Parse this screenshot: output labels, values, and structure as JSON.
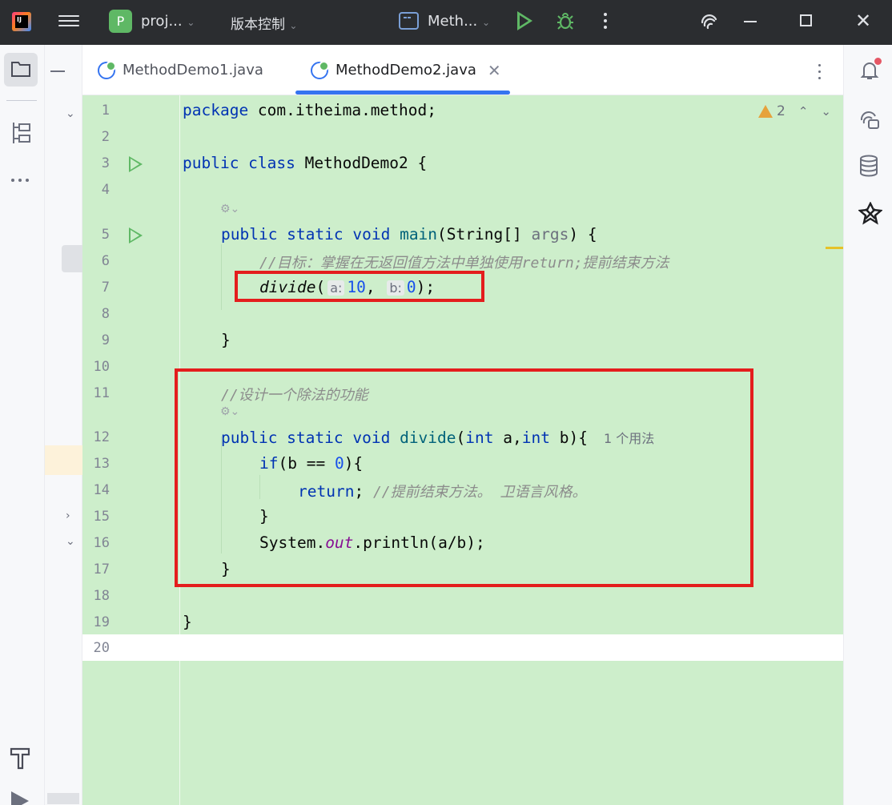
{
  "titlebar": {
    "project_badge": "P",
    "project_name": "proj...",
    "vcs_label": "版本控制",
    "run_config": "Meth...",
    "close_glyph": "✕"
  },
  "tabs": [
    {
      "label": "MethodDemo1.java",
      "active": false
    },
    {
      "label": "MethodDemo2.java",
      "active": true
    }
  ],
  "tab_close_glyph": "✕",
  "editor": {
    "warnings_count": "2",
    "lines": [
      {
        "n": "1",
        "code": "package com.itheima.method;"
      },
      {
        "n": "2",
        "code": ""
      },
      {
        "n": "3",
        "code": "public class MethodDemo2 {"
      },
      {
        "n": "4",
        "code": ""
      },
      {
        "n": "5",
        "code": "public static void main(String[] args) {"
      },
      {
        "n": "6",
        "code": "//目标：掌握在无返回值方法中单独使用return;提前结束方法"
      },
      {
        "n": "7",
        "code": "divide( a: 10, b: 0);",
        "call": "divide",
        "hint_a": "a:",
        "arg_a": "10",
        "hint_b": "b:",
        "arg_b": "0"
      },
      {
        "n": "8",
        "code": ""
      },
      {
        "n": "9",
        "code": "}"
      },
      {
        "n": "10",
        "code": ""
      },
      {
        "n": "11",
        "code": "//设计一个除法的功能"
      },
      {
        "n": "12",
        "code": "public static void divide(int a,int b){",
        "usages": "1 个用法"
      },
      {
        "n": "13",
        "code": "if(b == 0){"
      },
      {
        "n": "14",
        "code": "return; //提前结束方法。 卫语言风格。"
      },
      {
        "n": "15",
        "code": "}"
      },
      {
        "n": "16",
        "code": "System.out.println(a/b);"
      },
      {
        "n": "17",
        "code": "}"
      },
      {
        "n": "18",
        "code": ""
      },
      {
        "n": "19",
        "code": "}"
      },
      {
        "n": "20",
        "code": ""
      }
    ]
  },
  "colors": {
    "editor_bg": "#cdeecb",
    "keyword": "#0033b3",
    "accent": "#3574f0",
    "annotation_box": "#e41d1d",
    "run_green": "#5fb865"
  }
}
